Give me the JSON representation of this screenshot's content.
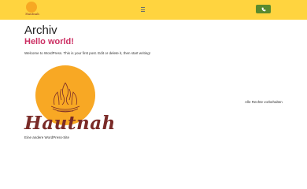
{
  "header": {
    "brand_text": "Hautnah",
    "menu_icon": "hamburger-icon",
    "cta_icon": "phone-icon",
    "bar_color": "#ffd43f",
    "cta_color": "#5a8a2e"
  },
  "main": {
    "page_title": "Archiv",
    "post": {
      "title": "Hello world!",
      "excerpt": "Welcome to WordPress. This is your first post. Edit or delete it, then start writing!"
    }
  },
  "footer": {
    "logo_text": "Hautnah",
    "tagline": "Eine andere WordPress-Site",
    "rights": "Alle Rechte vorbehalten"
  }
}
